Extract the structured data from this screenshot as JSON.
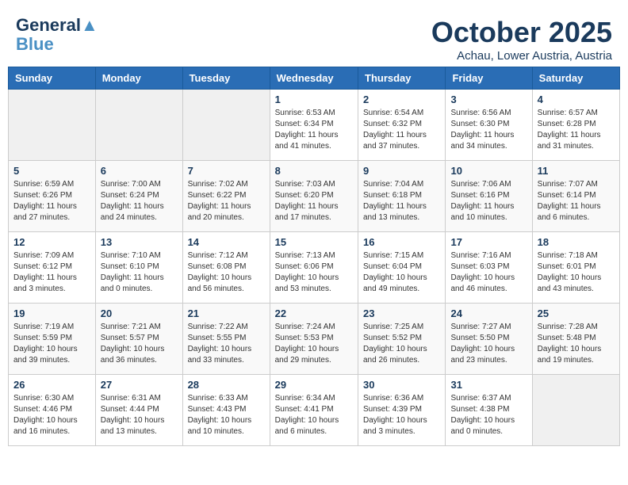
{
  "header": {
    "logo_line1": "General",
    "logo_line2": "Blue",
    "month": "October 2025",
    "location": "Achau, Lower Austria, Austria"
  },
  "weekdays": [
    "Sunday",
    "Monday",
    "Tuesday",
    "Wednesday",
    "Thursday",
    "Friday",
    "Saturday"
  ],
  "weeks": [
    [
      {
        "day": "",
        "info": ""
      },
      {
        "day": "",
        "info": ""
      },
      {
        "day": "",
        "info": ""
      },
      {
        "day": "1",
        "info": "Sunrise: 6:53 AM\nSunset: 6:34 PM\nDaylight: 11 hours\nand 41 minutes."
      },
      {
        "day": "2",
        "info": "Sunrise: 6:54 AM\nSunset: 6:32 PM\nDaylight: 11 hours\nand 37 minutes."
      },
      {
        "day": "3",
        "info": "Sunrise: 6:56 AM\nSunset: 6:30 PM\nDaylight: 11 hours\nand 34 minutes."
      },
      {
        "day": "4",
        "info": "Sunrise: 6:57 AM\nSunset: 6:28 PM\nDaylight: 11 hours\nand 31 minutes."
      }
    ],
    [
      {
        "day": "5",
        "info": "Sunrise: 6:59 AM\nSunset: 6:26 PM\nDaylight: 11 hours\nand 27 minutes."
      },
      {
        "day": "6",
        "info": "Sunrise: 7:00 AM\nSunset: 6:24 PM\nDaylight: 11 hours\nand 24 minutes."
      },
      {
        "day": "7",
        "info": "Sunrise: 7:02 AM\nSunset: 6:22 PM\nDaylight: 11 hours\nand 20 minutes."
      },
      {
        "day": "8",
        "info": "Sunrise: 7:03 AM\nSunset: 6:20 PM\nDaylight: 11 hours\nand 17 minutes."
      },
      {
        "day": "9",
        "info": "Sunrise: 7:04 AM\nSunset: 6:18 PM\nDaylight: 11 hours\nand 13 minutes."
      },
      {
        "day": "10",
        "info": "Sunrise: 7:06 AM\nSunset: 6:16 PM\nDaylight: 11 hours\nand 10 minutes."
      },
      {
        "day": "11",
        "info": "Sunrise: 7:07 AM\nSunset: 6:14 PM\nDaylight: 11 hours\nand 6 minutes."
      }
    ],
    [
      {
        "day": "12",
        "info": "Sunrise: 7:09 AM\nSunset: 6:12 PM\nDaylight: 11 hours\nand 3 minutes."
      },
      {
        "day": "13",
        "info": "Sunrise: 7:10 AM\nSunset: 6:10 PM\nDaylight: 11 hours\nand 0 minutes."
      },
      {
        "day": "14",
        "info": "Sunrise: 7:12 AM\nSunset: 6:08 PM\nDaylight: 10 hours\nand 56 minutes."
      },
      {
        "day": "15",
        "info": "Sunrise: 7:13 AM\nSunset: 6:06 PM\nDaylight: 10 hours\nand 53 minutes."
      },
      {
        "day": "16",
        "info": "Sunrise: 7:15 AM\nSunset: 6:04 PM\nDaylight: 10 hours\nand 49 minutes."
      },
      {
        "day": "17",
        "info": "Sunrise: 7:16 AM\nSunset: 6:03 PM\nDaylight: 10 hours\nand 46 minutes."
      },
      {
        "day": "18",
        "info": "Sunrise: 7:18 AM\nSunset: 6:01 PM\nDaylight: 10 hours\nand 43 minutes."
      }
    ],
    [
      {
        "day": "19",
        "info": "Sunrise: 7:19 AM\nSunset: 5:59 PM\nDaylight: 10 hours\nand 39 minutes."
      },
      {
        "day": "20",
        "info": "Sunrise: 7:21 AM\nSunset: 5:57 PM\nDaylight: 10 hours\nand 36 minutes."
      },
      {
        "day": "21",
        "info": "Sunrise: 7:22 AM\nSunset: 5:55 PM\nDaylight: 10 hours\nand 33 minutes."
      },
      {
        "day": "22",
        "info": "Sunrise: 7:24 AM\nSunset: 5:53 PM\nDaylight: 10 hours\nand 29 minutes."
      },
      {
        "day": "23",
        "info": "Sunrise: 7:25 AM\nSunset: 5:52 PM\nDaylight: 10 hours\nand 26 minutes."
      },
      {
        "day": "24",
        "info": "Sunrise: 7:27 AM\nSunset: 5:50 PM\nDaylight: 10 hours\nand 23 minutes."
      },
      {
        "day": "25",
        "info": "Sunrise: 7:28 AM\nSunset: 5:48 PM\nDaylight: 10 hours\nand 19 minutes."
      }
    ],
    [
      {
        "day": "26",
        "info": "Sunrise: 6:30 AM\nSunset: 4:46 PM\nDaylight: 10 hours\nand 16 minutes."
      },
      {
        "day": "27",
        "info": "Sunrise: 6:31 AM\nSunset: 4:44 PM\nDaylight: 10 hours\nand 13 minutes."
      },
      {
        "day": "28",
        "info": "Sunrise: 6:33 AM\nSunset: 4:43 PM\nDaylight: 10 hours\nand 10 minutes."
      },
      {
        "day": "29",
        "info": "Sunrise: 6:34 AM\nSunset: 4:41 PM\nDaylight: 10 hours\nand 6 minutes."
      },
      {
        "day": "30",
        "info": "Sunrise: 6:36 AM\nSunset: 4:39 PM\nDaylight: 10 hours\nand 3 minutes."
      },
      {
        "day": "31",
        "info": "Sunrise: 6:37 AM\nSunset: 4:38 PM\nDaylight: 10 hours\nand 0 minutes."
      },
      {
        "day": "",
        "info": ""
      }
    ]
  ]
}
